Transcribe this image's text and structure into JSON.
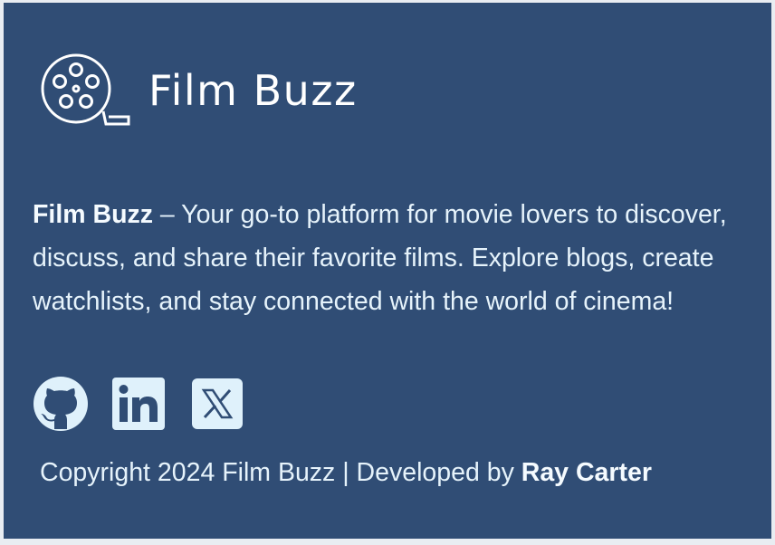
{
  "brand": {
    "name": "Film Buzz",
    "logo_icon": "film-reel-icon"
  },
  "about": {
    "brand_name": "Film Buzz",
    "description": " – Your go-to platform for movie lovers to discover, discuss, and share their favorite films. Explore blogs, create watchlists, and stay connected with the world of cinema!"
  },
  "socials": [
    {
      "name": "GitHub",
      "icon": "github-icon"
    },
    {
      "name": "LinkedIn",
      "icon": "linkedin-icon"
    },
    {
      "name": "X",
      "icon": "x-icon"
    }
  ],
  "copyright": {
    "text": "Copyright 2024 Film Buzz | Developed by ",
    "author": "Ray Carter"
  },
  "colors": {
    "background": "#304d75",
    "text": "#e6f3fb",
    "icon": "#dff1fb"
  }
}
